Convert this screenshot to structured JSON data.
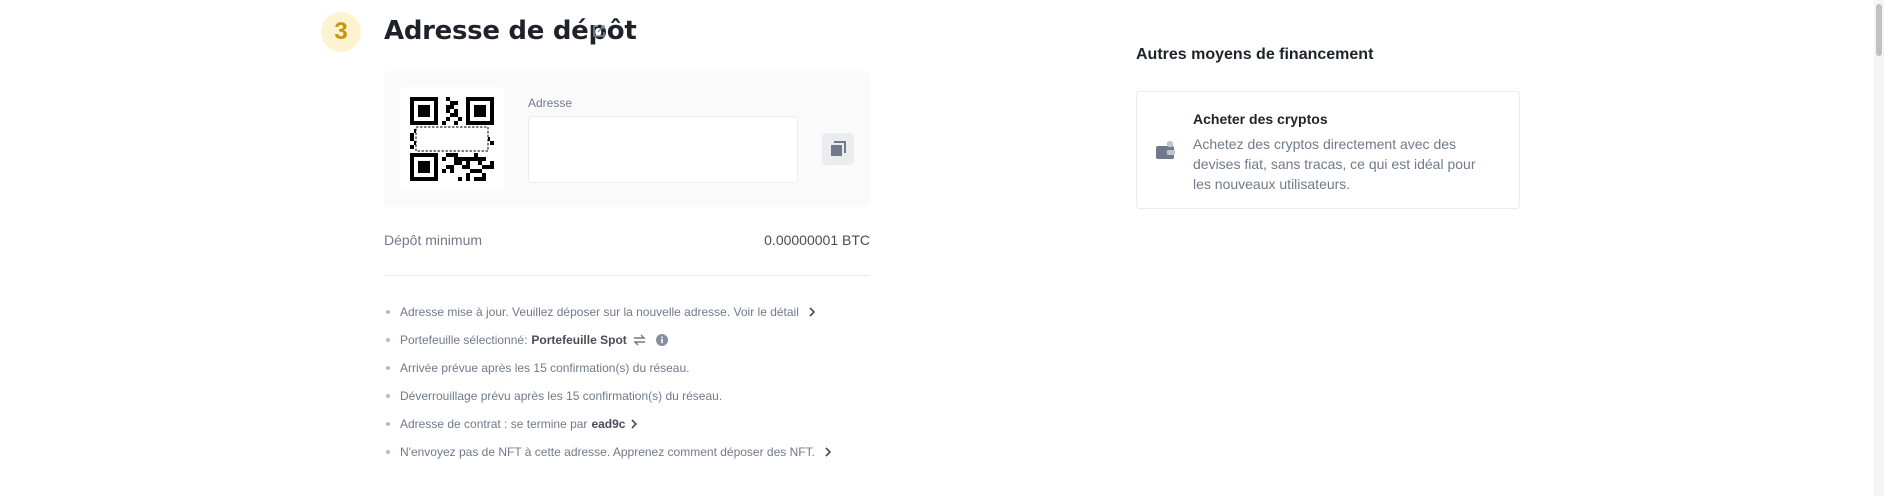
{
  "step": {
    "number": "3",
    "title": "Adresse de dépôt"
  },
  "address": {
    "label": "Adresse",
    "value": ""
  },
  "minimum_deposit": {
    "label": "Dépôt minimum",
    "value": "0.00000001 BTC"
  },
  "notes": {
    "updated": "Adresse mise à jour. Veuillez déposer sur la nouvelle adresse. Voir le détail",
    "wallet_label": "Portefeuille sélectionné:",
    "wallet_name": "Portefeuille Spot",
    "arrival": "Arrivée prévue après les 15 confirmation(s) du réseau.",
    "unlock": "Déverrouillage prévu après les 15 confirmation(s) du réseau.",
    "contract_label": "Adresse de contrat : se termine par",
    "contract_suffix": "ead9c",
    "nft": "N'envoyez pas de NFT à cette adresse. Apprenez comment déposer des NFT."
  },
  "sidebar": {
    "title": "Autres moyens de financement",
    "card": {
      "title": "Acheter des cryptos",
      "description": "Achetez des cryptos directement avec des devises fiat, sans tracas, ce qui est idéal pour les nouveaux utilisateurs."
    }
  },
  "icons": {
    "edit": "edit-icon",
    "copy": "copy-icon",
    "swap": "swap-icon",
    "info": "info-icon",
    "chevron": "chevron-right-icon",
    "wallet": "wallet-icon",
    "qr": "qr-code"
  },
  "colors": {
    "accent": "#c99400",
    "accent_bg": "#fdf3d0",
    "text_primary": "#1e2329",
    "text_secondary": "#707a8a"
  }
}
